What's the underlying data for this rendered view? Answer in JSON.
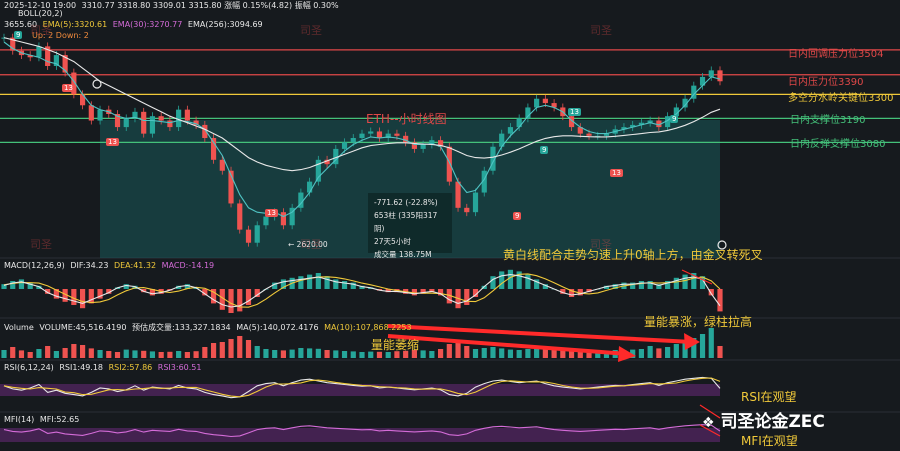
{
  "header": {
    "datetime": "2025-12-10 19:00",
    "ohlc": "3310.77  3318.80  3309.01  3315.80  涨幅 0.15%(4.82)  振幅 0.30%",
    "line2": "3655.60",
    "ema5": "EMA(5):3320.61",
    "ema30": "EMA(30):3270.77",
    "ema256": "EMA(256):3094.69",
    "boll": "BOLL(20,2)",
    "up_down": "Up: 2  Down: 2"
  },
  "price_levels": [
    {
      "label": "日内回调压力位3504",
      "value": 3504,
      "color": "#e04848"
    },
    {
      "label": "日内压力位3390",
      "value": 3390,
      "color": "#e04848"
    },
    {
      "label": "多空分水岭关键位3300",
      "value": 3300,
      "color": "#f0c93a"
    },
    {
      "label": "日内支撑位3190",
      "value": 3190,
      "color": "#44c17a"
    },
    {
      "label": "日内反弹支撑位3080",
      "value": 3080,
      "color": "#44c17a"
    }
  ],
  "chart_title": "ETH--小时线图",
  "tooltip": {
    "line1": "-771.62 (-22.8%)",
    "line2": "653柱 (335阳317阴)",
    "line3": "27天5小时",
    "line4": "成交量 138.75M"
  },
  "low_label": "2620.00",
  "annotations": {
    "macd_note": "黄白线配合走势匀速上升0轴上方，由金叉转死叉",
    "vol_up": "量能暴涨，绿柱拉高",
    "vol_down": "量能萎缩",
    "rsi_note": "RSI在观望",
    "mfi_note": "MFI在观望"
  },
  "panels": {
    "macd": {
      "name": "MACD(12,26,9)",
      "dif": "DIF:34.23",
      "dea": "DEA:41.32",
      "macd": "MACD:-14.19"
    },
    "volume": {
      "name": "Volume",
      "vol": "VOLUME:45,516.4190",
      "est": "预估成交量:133,327.1834",
      "ma5": "MA(5):140,072.4176",
      "ma10": "MA(10):107,868.2253"
    },
    "rsi": {
      "name": "RSI(6,12,24)",
      "rsi1": "RSI1:49.18",
      "rsi2": "RSI2:57.86",
      "rsi3": "RSI3:60.51"
    },
    "mfi": {
      "name": "MFI(14)",
      "mfi": "MFI:52.65"
    }
  },
  "brand": "司圣论金ZEC",
  "watermark": "司圣",
  "colors": {
    "bg": "#161a1e",
    "up": "#26a69a",
    "down": "#ef5350",
    "teal_zone": "#1a5a5a",
    "yellow": "#f0c93a",
    "purple": "#6a2a7a"
  },
  "chart_data": {
    "type": "candlestick",
    "title": "ETH--小时线图",
    "ylim": [
      2550,
      3650
    ],
    "close_path": [
      3560,
      3500,
      3480,
      3470,
      3520,
      3430,
      3480,
      3400,
      3300,
      3250,
      3180,
      3230,
      3210,
      3150,
      3190,
      3220,
      3120,
      3200,
      3180,
      3150,
      3230,
      3180,
      3160,
      3100,
      3000,
      2950,
      2800,
      2680,
      2620,
      2700,
      2740,
      2760,
      2700,
      2780,
      2850,
      2900,
      3000,
      2980,
      3050,
      3080,
      3100,
      3120,
      3130,
      3100,
      3120,
      3110,
      3080,
      3050,
      3070,
      3090,
      3060,
      2900,
      2780,
      2760,
      2850,
      2950,
      3060,
      3120,
      3150,
      3190,
      3240,
      3280,
      3260,
      3240,
      3200,
      3150,
      3120,
      3110,
      3110,
      3120,
      3140,
      3150,
      3160,
      3170,
      3180,
      3150,
      3200,
      3240,
      3280,
      3340,
      3380,
      3410,
      3360
    ],
    "ema_fast": [
      3540,
      3510,
      3490,
      3480,
      3470,
      3450,
      3440,
      3410,
      3360,
      3300,
      3250,
      3230,
      3220,
      3200,
      3190,
      3195,
      3180,
      3180,
      3175,
      3170,
      3180,
      3175,
      3165,
      3140,
      3080,
      3020,
      2930,
      2840,
      2780,
      2760,
      2755,
      2760,
      2740,
      2760,
      2800,
      2850,
      2920,
      2960,
      3000,
      3040,
      3070,
      3090,
      3105,
      3100,
      3105,
      3100,
      3090,
      3070,
      3070,
      3075,
      3060,
      2990,
      2900,
      2850,
      2860,
      2910,
      2990,
      3060,
      3110,
      3150,
      3200,
      3240,
      3250,
      3240,
      3220,
      3180,
      3150,
      3130,
      3120,
      3120,
      3130,
      3140,
      3150,
      3160,
      3170,
      3160,
      3180,
      3210,
      3250,
      3300,
      3340,
      3380,
      3370
    ],
    "ema_slow": [
      3560,
      3550,
      3540,
      3530,
      3520,
      3505,
      3490,
      3470,
      3450,
      3420,
      3390,
      3360,
      3340,
      3320,
      3300,
      3280,
      3260,
      3240,
      3220,
      3200,
      3185,
      3170,
      3155,
      3140,
      3120,
      3100,
      3070,
      3040,
      3010,
      2990,
      2975,
      2965,
      2955,
      2950,
      2955,
      2965,
      2980,
      2995,
      3010,
      3025,
      3040,
      3055,
      3065,
      3070,
      3075,
      3078,
      3078,
      3075,
      3072,
      3070,
      3066,
      3055,
      3038,
      3020,
      3010,
      3008,
      3012,
      3022,
      3035,
      3050,
      3068,
      3085,
      3098,
      3106,
      3110,
      3110,
      3108,
      3106,
      3105,
      3105,
      3108,
      3112,
      3116,
      3120,
      3125,
      3128,
      3135,
      3145,
      3158,
      3175,
      3195,
      3218,
      3232
    ],
    "macd_hist": [
      3,
      5,
      6,
      4,
      2,
      -3,
      -6,
      -8,
      -10,
      -12,
      -9,
      -6,
      -3,
      1,
      3,
      2,
      -2,
      -4,
      -3,
      -1,
      2,
      3,
      1,
      -4,
      -9,
      -13,
      -15,
      -14,
      -10,
      -5,
      0,
      4,
      6,
      7,
      8,
      9,
      10,
      8,
      6,
      5,
      4,
      2,
      1,
      -1,
      -2,
      -2,
      -3,
      -4,
      -3,
      -2,
      -4,
      -9,
      -12,
      -10,
      -5,
      2,
      8,
      11,
      12,
      11,
      9,
      6,
      3,
      0,
      -3,
      -5,
      -4,
      -2,
      0,
      2,
      3,
      4,
      4,
      5,
      5,
      3,
      5,
      7,
      9,
      10,
      8,
      -4,
      -14
    ],
    "volume": [
      40,
      55,
      38,
      30,
      45,
      60,
      35,
      50,
      70,
      65,
      48,
      40,
      35,
      30,
      42,
      38,
      36,
      33,
      30,
      31,
      35,
      30,
      34,
      55,
      75,
      80,
      95,
      110,
      90,
      60,
      45,
      40,
      38,
      42,
      50,
      48,
      46,
      40,
      38,
      35,
      33,
      30,
      32,
      31,
      30,
      34,
      36,
      40,
      38,
      35,
      45,
      70,
      85,
      60,
      45,
      50,
      55,
      48,
      42,
      40,
      45,
      50,
      44,
      40,
      38,
      36,
      34,
      33,
      32,
      35,
      40,
      38,
      42,
      45,
      60,
      48,
      55,
      70,
      85,
      100,
      120,
      150,
      60
    ],
    "rsi": [
      55,
      48,
      45,
      50,
      58,
      40,
      45,
      38,
      35,
      32,
      40,
      50,
      48,
      42,
      46,
      55,
      45,
      52,
      50,
      48,
      56,
      50,
      48,
      40,
      35,
      32,
      28,
      30,
      42,
      55,
      60,
      62,
      55,
      62,
      68,
      70,
      66,
      62,
      60,
      58,
      56,
      54,
      55,
      50,
      52,
      50,
      48,
      46,
      48,
      50,
      46,
      35,
      32,
      38,
      52,
      60,
      66,
      68,
      65,
      62,
      64,
      66,
      60,
      55,
      52,
      50,
      48,
      50,
      52,
      54,
      56,
      55,
      58,
      60,
      62,
      56,
      62,
      66,
      70,
      72,
      74,
      72,
      49
    ]
  }
}
